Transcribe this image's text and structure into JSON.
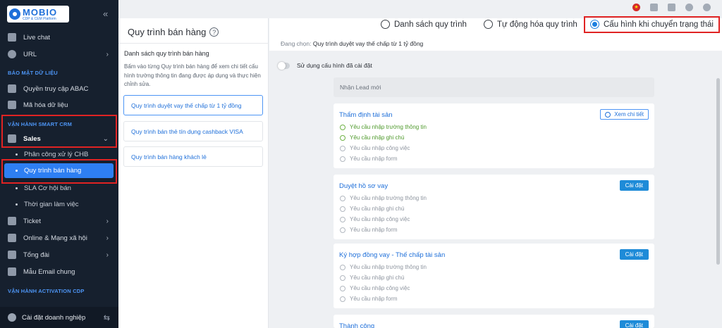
{
  "brand": {
    "name": "MOBIO",
    "tagline": "CDP & CEM Platform"
  },
  "sidebar": {
    "collapse_glyph": "«",
    "items_top": [
      {
        "label": "Live chat",
        "icon": "chat-icon"
      },
      {
        "label": "URL",
        "icon": "link-icon"
      }
    ],
    "sections": {
      "data_security": "BẢO MẬT DỮ LIỆU",
      "smart_crm": "VẬN HÀNH SMART CRM",
      "activation_cdp": "VẬN HÀNH ACTIVATION CDP"
    },
    "security_items": [
      {
        "label": "Quyền truy cập ABAC",
        "icon": "shield-icon"
      },
      {
        "label": "Mã hóa dữ liệu",
        "icon": "lock-icon"
      }
    ],
    "sales": {
      "label": "Sales",
      "icon": "sales-icon"
    },
    "sales_sub": [
      {
        "label": "Phân công xử lý CHB"
      },
      {
        "label": "Quy trình bán hàng"
      },
      {
        "label": "SLA Cơ hội bán"
      },
      {
        "label": "Thời gian làm việc"
      }
    ],
    "items_bottom": [
      {
        "label": "Ticket",
        "icon": "ticket-icon"
      },
      {
        "label": "Online & Mạng xã hội",
        "icon": "social-icon"
      },
      {
        "label": "Tổng đài",
        "icon": "phone-icon"
      },
      {
        "label": "Mẫu Email chung",
        "icon": "mail-icon"
      }
    ],
    "footer": {
      "label": "Cài đặt doanh nghiệp",
      "switch_glyph": "⇆"
    }
  },
  "left_panel": {
    "title": "Quy trình bán hàng",
    "subtitle": "Danh sách quy trình bán hàng",
    "description": "Bấm vào từng Quy trình bán hàng để xem chi tiết cấu hình trường thông tin đang được áp dụng và thực hiện chỉnh sửa.",
    "processes": [
      "Quy trình duyệt vay thế chấp từ 1 tỷ đồng",
      "Quy trình bán thẻ tín dụng cashback VISA",
      "Quy trình bán hàng khách lẻ"
    ]
  },
  "main": {
    "modes": [
      {
        "label": "Danh sách quy trình",
        "selected": false
      },
      {
        "label": "Tự động hóa quy trình",
        "selected": false
      },
      {
        "label": "Cấu hình khi chuyển trạng thái",
        "selected": true
      }
    ],
    "current_prefix": "Đang chọn:",
    "current_value": "Quy trình duyệt vay thế chấp từ 1 tỷ đồng",
    "toggle_label": "Sử dụng cấu hình đã cài đặt",
    "lead_stage": "Nhận Lead mới",
    "view_detail_label": "Xem chi tiết",
    "setup_label": "Cài đặt",
    "requirements": [
      "Yêu cầu nhập trường thông tin",
      "Yêu cầu nhập ghi chú",
      "Yêu cầu nhập công việc",
      "Yêu cầu nhập form"
    ],
    "stages": [
      {
        "name": "Thẩm định tài sản",
        "action": "view",
        "completed": [
          true,
          true,
          false,
          false
        ]
      },
      {
        "name": "Duyệt hồ sơ vay",
        "action": "setup",
        "completed": [
          false,
          false,
          false,
          false
        ]
      },
      {
        "name": "Ký hợp đồng vay - Thế chấp tài sản",
        "action": "setup",
        "completed": [
          false,
          false,
          false,
          false
        ]
      },
      {
        "name": "Thành công",
        "action": "setup",
        "completed": []
      }
    ]
  },
  "colors": {
    "accent": "#2e7ff2",
    "highlight": "#e02323",
    "sidebar_bg": "#16202e",
    "link": "#1e6fd9",
    "done": "#4f9a2c"
  }
}
